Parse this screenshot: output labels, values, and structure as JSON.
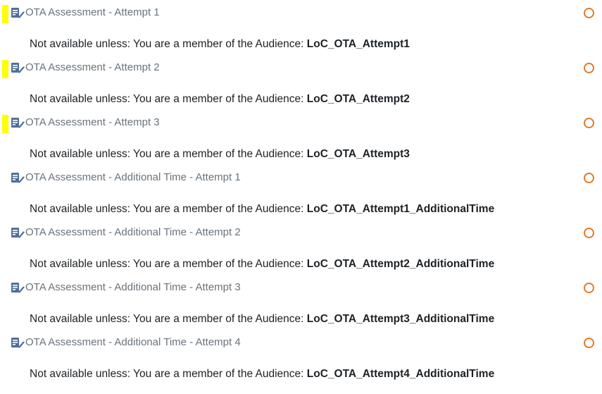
{
  "activities": [
    {
      "title": "OTA Assessment - Attempt 1",
      "highlighted": true,
      "icon": "assignment-icon",
      "restriction_prefix": "Not available unless: You are a member of the Audience:",
      "audience": "LoC_OTA_Attempt1"
    },
    {
      "title": "OTA Assessment - Attempt 2",
      "highlighted": true,
      "icon": "assignment-icon",
      "restriction_prefix": "Not available unless: You are a member of the Audience:",
      "audience": "LoC_OTA_Attempt2"
    },
    {
      "title": "OTA Assessment - Attempt 3",
      "highlighted": true,
      "icon": "assignment-icon",
      "restriction_prefix": "Not available unless: You are a member of the Audience:",
      "audience": "LoC_OTA_Attempt3"
    },
    {
      "title": "OTA Assessment - Additional Time - Attempt 1",
      "highlighted": false,
      "icon": "assignment-icon",
      "restriction_prefix": "Not available unless: You are a member of the Audience:",
      "audience": "LoC_OTA_Attempt1_AdditionalTime"
    },
    {
      "title": "OTA Assessment - Additional Time - Attempt 2",
      "highlighted": false,
      "icon": "assignment-icon",
      "restriction_prefix": "Not available unless: You are a member of the Audience:",
      "audience": "LoC_OTA_Attempt2_AdditionalTime"
    },
    {
      "title": "OTA Assessment - Additional Time - Attempt 3",
      "highlighted": false,
      "icon": "assignment-icon",
      "restriction_prefix": "Not available unless: You are a member of the Audience:",
      "audience": "LoC_OTA_Attempt3_AdditionalTime"
    },
    {
      "title": "OTA Assessment - Additional Time - Attempt 4",
      "highlighted": false,
      "icon": "assignment-icon",
      "restriction_prefix": "Not available unless: You are a member of the Audience:",
      "audience": "LoC_OTA_Attempt4_AdditionalTime"
    }
  ],
  "colors": {
    "highlight": "#ffff00",
    "link": "#6a737b",
    "completion": "#e07a28",
    "text": "#1d2125",
    "icon": "#4f6f9f"
  }
}
